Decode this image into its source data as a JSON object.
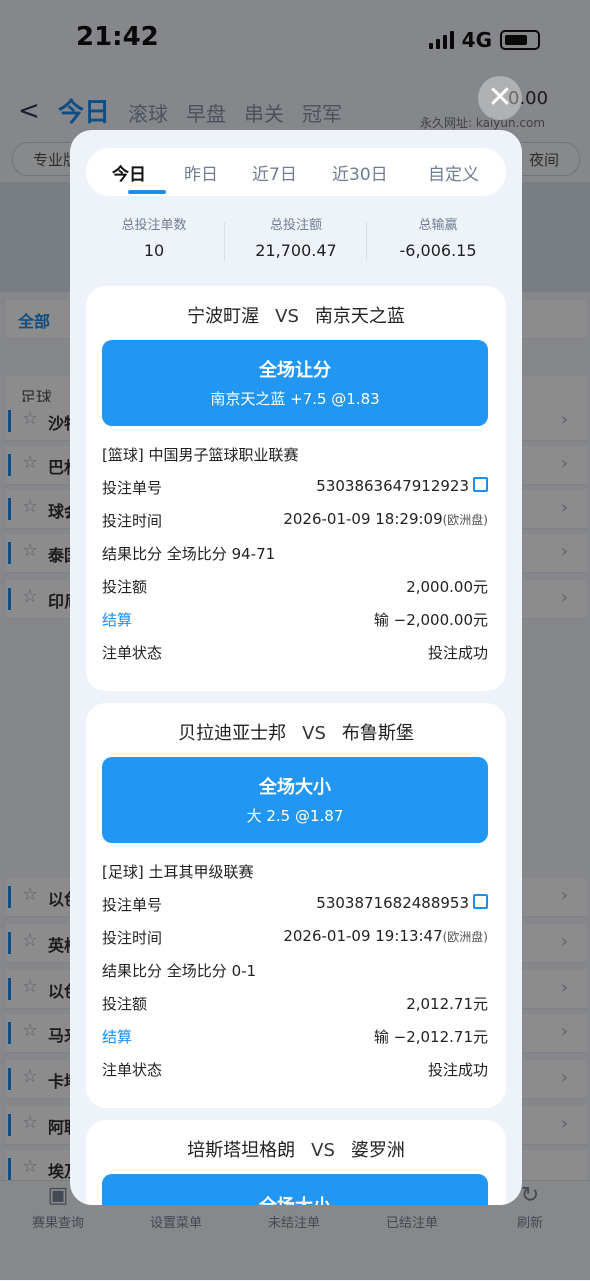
{
  "status_bar": {
    "time": "21:42",
    "network": "4G"
  },
  "background": {
    "back_glyph": "<",
    "nav_tabs": [
      "今日",
      "滚球",
      "早盘",
      "串关",
      "冠军"
    ],
    "balance": "0.00",
    "domain_label": "永久网址: kaiyun.com",
    "filter_left": "专业版",
    "filter_right": "夜间",
    "section_label": "全部",
    "sports_label": "足球",
    "rows": [
      "沙特",
      "巴林",
      "球会",
      "泰国",
      "印尼",
      "以色",
      "英格",
      "以色",
      "马来",
      "卡塔",
      "阿联",
      "埃及"
    ],
    "bottom_nav": [
      "赛果查询",
      "设置菜单",
      "未结注单",
      "已结注单",
      "刷新"
    ]
  },
  "modal": {
    "tabs": [
      "今日",
      "昨日",
      "近7日",
      "近30日",
      "自定义"
    ],
    "active_tab": 0,
    "summary": [
      {
        "label": "总投注单数",
        "value": "10"
      },
      {
        "label": "总投注额",
        "value": "21,700.47"
      },
      {
        "label": "总输赢",
        "value": "-6,006.15"
      }
    ],
    "labels": {
      "vs": "VS",
      "order_no": "投注单号",
      "bet_time": "投注时间",
      "result_score": "结果比分",
      "amount": "投注额",
      "settle": "结算",
      "status": "注单状态"
    },
    "bets": [
      {
        "home": "宁波町渥",
        "away": "南京天之蓝",
        "market": "全场让分",
        "selection": "南京天之蓝  +7.5 @1.83",
        "league": "[篮球] 中国男子篮球职业联赛",
        "order_no": "5303863647912923",
        "bet_time": "2026-01-09 18:29:09",
        "odds_type": "(欧洲盘)",
        "result_score": "全场比分 94-71",
        "amount": "2,000.00元",
        "settle": "输 −2,000.00元",
        "status": "投注成功"
      },
      {
        "home": "贝拉迪亚士邦",
        "away": "布鲁斯堡",
        "market": "全场大小",
        "selection": "大 2.5 @1.87",
        "league": "[足球] 土耳其甲级联赛",
        "order_no": "5303871682488953",
        "bet_time": "2026-01-09 19:13:47",
        "odds_type": "(欧洲盘)",
        "result_score": "全场比分 0-1",
        "amount": "2,012.71元",
        "settle": "输 −2,012.71元",
        "status": "投注成功"
      },
      {
        "home": "培斯塔坦格朗",
        "away": "婆罗洲",
        "market": "全场大小"
      }
    ]
  },
  "icons": {
    "close": "close-icon",
    "copy": "copy-icon"
  },
  "colors": {
    "accent": "#2197f3",
    "text": "#222222",
    "muted": "#6f7e94"
  }
}
